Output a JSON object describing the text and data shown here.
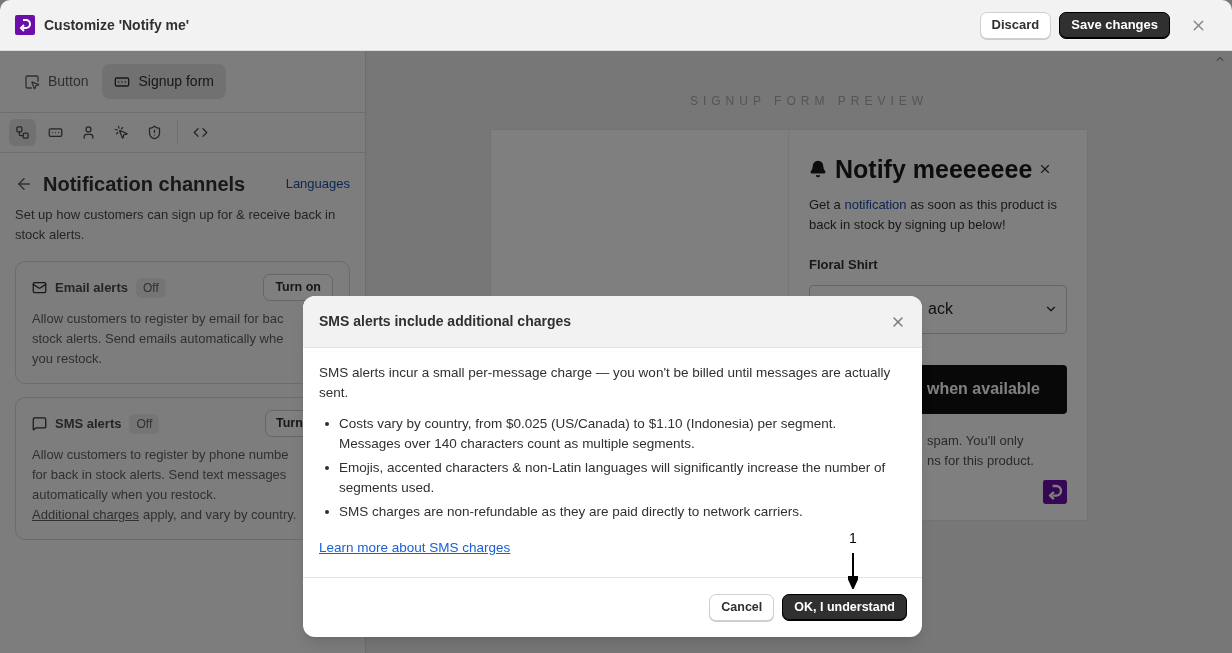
{
  "header": {
    "title": "Customize 'Notify me'",
    "buttons": [
      {
        "label": "Discard",
        "kind": "secondary"
      },
      {
        "label": "Save changes",
        "kind": "primary"
      }
    ]
  },
  "sidebar": {
    "tabs": [
      {
        "label": "Button",
        "selected": false
      },
      {
        "label": "Signup form",
        "selected": true
      }
    ],
    "tools": [
      {
        "selected": true
      },
      {
        "selected": false
      },
      {
        "selected": false
      },
      {
        "selected": false
      },
      {
        "selected": false
      },
      {
        "selected": false
      }
    ],
    "section": {
      "title": "Notification channels",
      "link": "Languages",
      "description": "Set up how customers can sign up for & receive back in stock alerts."
    },
    "channels": [
      {
        "kind": "email",
        "name": "Email alerts",
        "status": "Off",
        "action": "Turn on",
        "lines": [
          "Allow customers to register by email for bac",
          "stock alerts. Send emails automatically whe",
          "you restock."
        ]
      },
      {
        "kind": "sms",
        "name": "SMS alerts",
        "status": "Off",
        "action": "Turn",
        "lines": [
          "Allow customers to register by phone numbe",
          "for back in stock alerts. Send text messages"
        ],
        "tail": "automatically when you restock.",
        "link": "Additional charges",
        "after": "apply, and vary by country."
      }
    ]
  },
  "preview": {
    "label": "SIGNUP FORM PREVIEW",
    "title": "Notify meeeeeee",
    "text_before": "Get a",
    "text_link": "notification",
    "text_after": "as soon as this product is back in stock by signing up below!",
    "product": "Floral Shirt",
    "select_value": "ack",
    "button": "when available",
    "footer_lines": [
      "spam. You'll only",
      "ns for this product."
    ]
  },
  "dialog": {
    "title": "SMS alerts include additional charges",
    "intro": "SMS alerts incur a small per-message charge — you won't be billed until messages are actually sent.",
    "bullets": [
      "Costs vary by country, from $0.025 (US/Canada) to $1.10 (Indonesia) per segment. Messages over 140 characters count as multiple segments.",
      "Emojis, accented characters & non-Latin languages will significantly increase the number of segments used.",
      "SMS charges are non-refundable as they are paid directly to network carriers."
    ],
    "link": "Learn more about SMS charges",
    "buttons": [
      {
        "label": "Cancel",
        "kind": "secondary"
      },
      {
        "label": "OK, I understand",
        "kind": "primary"
      }
    ],
    "annotation": "1"
  }
}
